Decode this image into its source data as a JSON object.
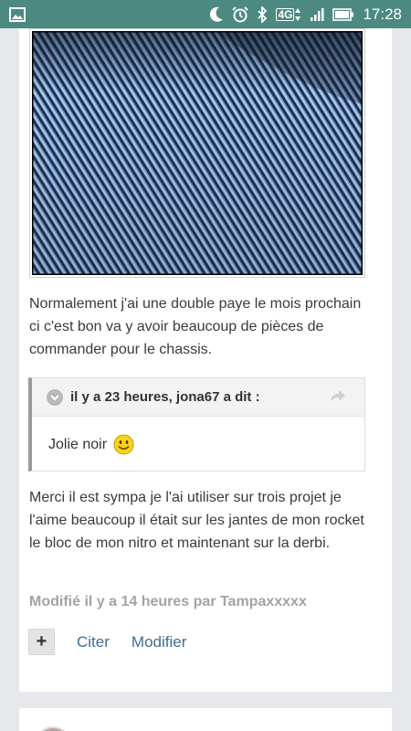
{
  "statusbar": {
    "network": "4G",
    "time": "17:28",
    "icons": [
      "gallery-icon",
      "moon-icon",
      "alarm-icon",
      "bluetooth-icon",
      "network-4g-icon",
      "signal-icon",
      "battery-icon"
    ]
  },
  "post": {
    "image": {
      "type": "blue carbon-fiber fabric photo"
    },
    "paragraph_1": "Normalement j'ai une double paye le mois prochain ci c'est bon va y avoir beaucoup de pièces de commander pour le chassis.",
    "quote": {
      "author_line": "il y a 23 heures, jona67 a dit :",
      "text": "Jolie noir"
    },
    "paragraph_2": "Merci il est sympa je l'ai utiliser sur trois projet je l'aime beaucoup il était sur les jantes de mon rocket le bloc de mon nitro et maintenant sur la derbi.",
    "modified": "Modifié il y a 14 heures par Tampaxxxxx",
    "actions": {
      "plus": "+",
      "quote": "Citer",
      "edit": "Modifier"
    }
  },
  "colors": {
    "statusbar": "#4c8a81",
    "link": "#3d6d94",
    "background": "#e6e8ec"
  }
}
